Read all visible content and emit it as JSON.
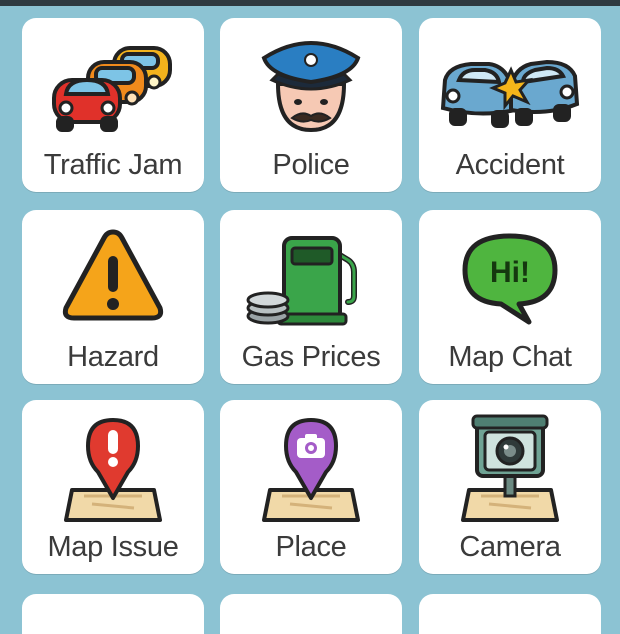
{
  "report_menu": {
    "items": [
      {
        "label": "Traffic Jam",
        "icon": "traffic-jam-icon"
      },
      {
        "label": "Police",
        "icon": "police-icon"
      },
      {
        "label": "Accident",
        "icon": "accident-icon"
      },
      {
        "label": "Hazard",
        "icon": "hazard-icon"
      },
      {
        "label": "Gas Prices",
        "icon": "gas-prices-icon"
      },
      {
        "label": "Map Chat",
        "icon": "map-chat-icon"
      },
      {
        "label": "Map Issue",
        "icon": "map-issue-icon"
      },
      {
        "label": "Place",
        "icon": "place-icon"
      },
      {
        "label": "Camera",
        "icon": "camera-icon"
      }
    ],
    "chat_bubble_text": "Hi!"
  },
  "colors": {
    "background": "#8cc3d3",
    "tile": "#ffffff",
    "label_text": "#3b3b3b"
  }
}
